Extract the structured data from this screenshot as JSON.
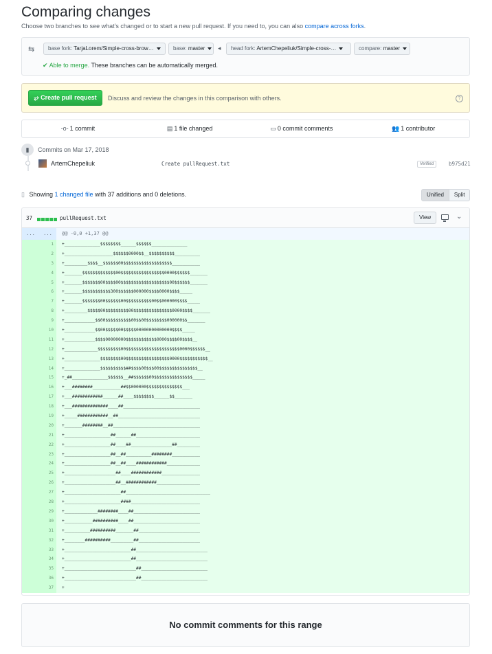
{
  "page": {
    "title": "Comparing changes",
    "subtitle": "Choose two branches to see what’s changed or to start a new pull request. If you need to, you can also",
    "subtitle_link": "compare across forks",
    "subtitle_end": "."
  },
  "range": {
    "base_fork_label": "base fork:",
    "base_fork_value": "TarjaLorem/Simple-cross-brow…",
    "base_label": "base:",
    "base_value": "master",
    "head_fork_label": "head fork:",
    "head_fork_value": "ArtemChepeliuk/Simple-cross-…",
    "compare_label": "compare:",
    "compare_value": "master",
    "merge_status": "Able to merge.",
    "merge_detail": "These branches can be automatically merged."
  },
  "pull_request": {
    "button_label": "Create pull request",
    "description": "Discuss and review the changes in this comparison with others.",
    "help": "?"
  },
  "stats": {
    "commits": "1 commit",
    "files": "1 file changed",
    "comments": "0 commit comments",
    "contributors": "1 contributor"
  },
  "commits": {
    "date_header": "Commits on Mar 17, 2018",
    "author": "ArtemChepeliuk",
    "message": "Create pullRequest.txt",
    "badge": "Verified",
    "sha": "b975d21"
  },
  "summary": {
    "prefix": "Showing",
    "link": "1 changed file",
    "rest": "with 37 additions and 0 deletions.",
    "unified": "Unified",
    "split": "Split"
  },
  "file": {
    "count": "37",
    "name": "pullRequest.txt",
    "view_button": "View",
    "hunk_left": "...",
    "hunk_right": "...",
    "hunk_header": "@@ -0,0 +1,37 @@",
    "lines": [
      "+______________$$$$$$$$______$$$$$$______________",
      "+___________________$$$$$$0000$$__$$$$$$$$$$__________",
      "+_________$$$$__$$$$$$00$$$$$$$$$$$$$$$$$$$___________",
      "+_______$$$$$$$$$$$$$00$$$$$$$$$$$$$$$$$0000$$$$$$_______",
      "+_______$$$$$$$00$$$$00$$$$$$$$$$$$$$$$$$$00$$$$$$_______",
      "+_______$$$$$$$$$$$300$$$$$$000000$$$$0000$$$$_____",
      "+_______$$$$$$$00$$$$$$00$$$$$$$$$$00$$000000$$$$_____",
      "+_________$$$$$00$$$$$$$$$00$$$$$$$$$$$$$$$0000$$$$_______",
      "+____________$$00$$$$$$$$$$00$$00$$$$$$$$000000$$_______",
      "+____________$$00$$$$$00$$$$$00000000000000$$$$_____",
      "+____________$$$$00000000$$$$$$$$$$$$0000$$$$00$$$$__",
      "+_____________$$$$$$$$$00$$$$$$$$$$$$$$$$$$$$$0000$$$$$$__",
      "+______________$$$$$$$$00$$$$$$$$$$$$$$$$$0000$$$$$$$$$$$__",
      "+______________$$$$$$$$$$##$$$$00$$$00$$$$$$$$$$$$$$$__",
      "+_##______________$$$$$$__##$$$$$$00$$$$$$$$$$$$$$$_____",
      "+___########___________##$$000000$$$$$$$$$$$$$$___",
      "+___############______##____$$$$$$$$______$$_______",
      "+___##############____##______________________________",
      "+_____############__##________________________________",
      "+_______########__##__________________________________",
      "+__________________##______##_________________________",
      "+__________________##____##________________##_________",
      "+__________________##__##__________########___________",
      "+__________________##__##____############_____________",
      "+____________________##____############_______________",
      "+____________________##__############_________________",
      "+______________________##_________________________________",
      "+______________________####___________________________",
      "+_____________########____##__________________________",
      "+___________##########____##__________________________",
      "+__________##########_______##________________________",
      "+________##########_________##________________________",
      "+__________________________##____________________________",
      "+__________________________##____________________________",
      "+____________________________##__________________________",
      "+____________________________##__________________________",
      "+"
    ]
  },
  "footer": {
    "no_comments": "No commit comments for this range"
  }
}
